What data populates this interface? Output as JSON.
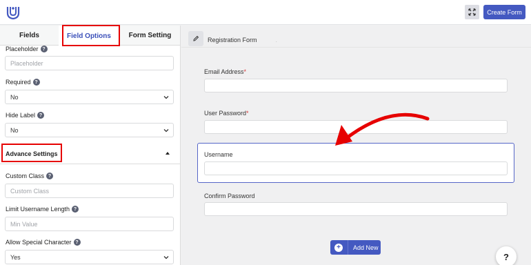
{
  "header": {
    "logo_icon": "ur-logo-icon",
    "expand_icon": "expand-icon",
    "create_form_label": "Create Form"
  },
  "sidebar": {
    "tabs": [
      {
        "label": "Fields"
      },
      {
        "label": "Field Options"
      },
      {
        "label": "Form Setting"
      }
    ],
    "placeholder": {
      "label": "Placeholder",
      "input_placeholder": "Placeholder"
    },
    "required": {
      "label": "Required",
      "value": "No"
    },
    "hide_label": {
      "label": "Hide Label",
      "value": "No"
    },
    "advance_settings": {
      "label": "Advance Settings"
    },
    "custom_class": {
      "label": "Custom Class",
      "input_placeholder": "Custom Class"
    },
    "limit_username": {
      "label": "Limit Username Length",
      "input_placeholder": "Min Value"
    },
    "allow_special": {
      "label": "Allow Special Character",
      "value": "Yes"
    }
  },
  "canvas": {
    "form_title": "Registration Form",
    "form_dot": ".",
    "fields": [
      {
        "label": "Email Address",
        "required": "*"
      },
      {
        "label": "User Password",
        "required": "*"
      },
      {
        "label": "Username",
        "required": ""
      },
      {
        "label": "Confirm Password",
        "required": ""
      }
    ],
    "add_new_label": "Add New",
    "help_label": "?"
  },
  "colors": {
    "accent": "#4459c1",
    "highlight": "#e60000",
    "selected_border": "#5565c7"
  }
}
